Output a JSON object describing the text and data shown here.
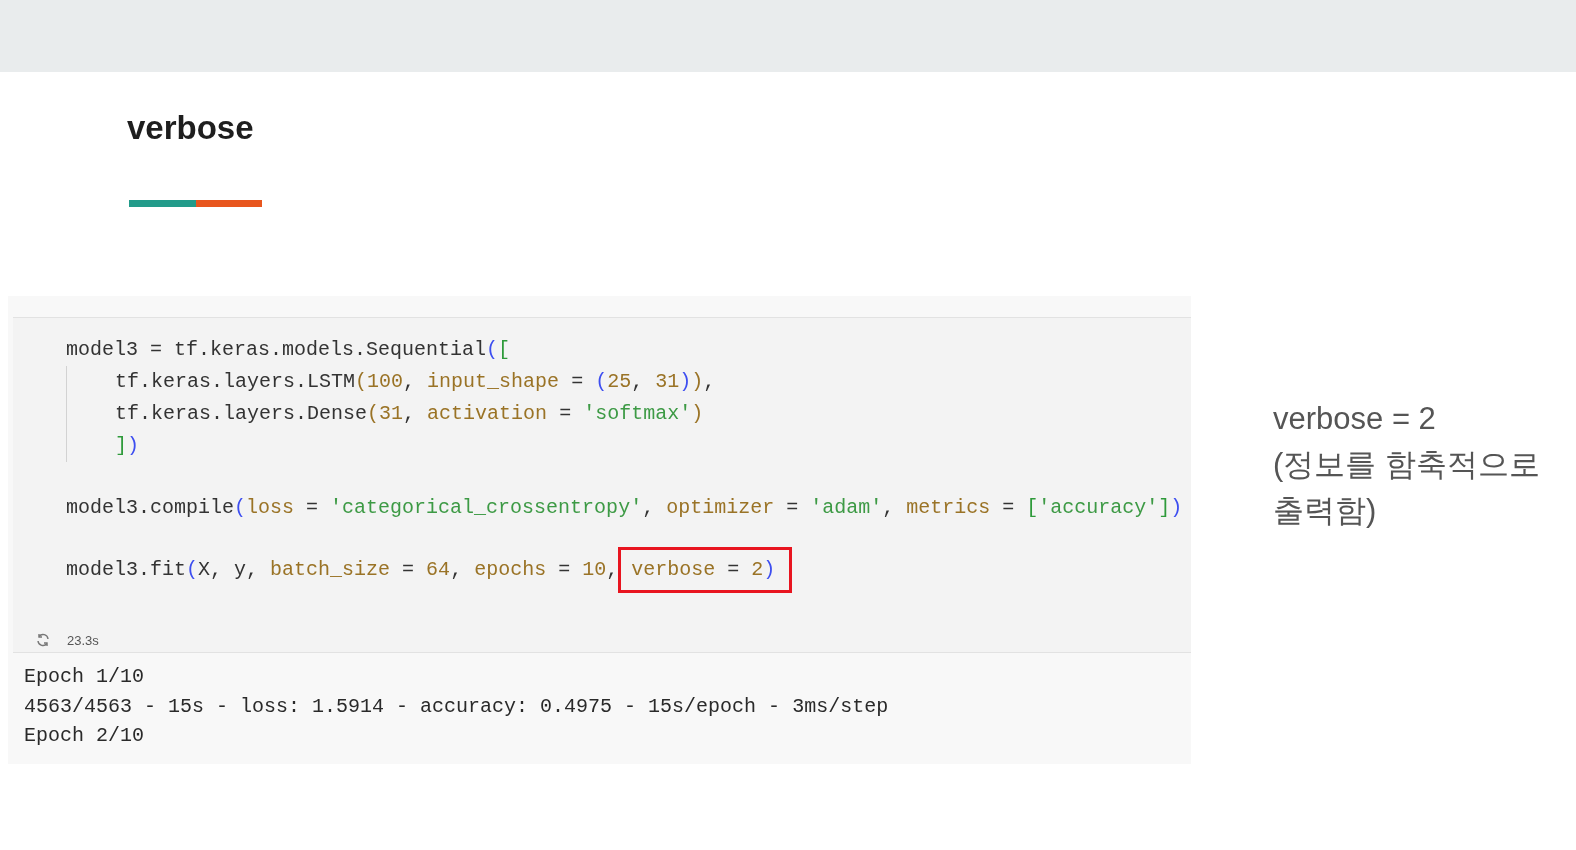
{
  "title": "verbose",
  "code_cell": {
    "blocks": [
      {
        "head": [
          {
            "t": "model3 = tf.keras.models.Sequential",
            "kind": "plain"
          },
          {
            "t": "(",
            "kind": "blue"
          },
          {
            "t": "[",
            "kind": "green"
          }
        ],
        "children": [
          [
            {
              "t": "tf.keras.layers.LSTM",
              "kind": "plain"
            },
            {
              "t": "(",
              "kind": "brown"
            },
            {
              "t": "100",
              "kind": "num"
            },
            {
              "t": ", ",
              "kind": "plain"
            },
            {
              "t": "input_shape",
              "kind": "arg"
            },
            {
              "t": " = ",
              "kind": "plain"
            },
            {
              "t": "(",
              "kind": "blue"
            },
            {
              "t": "25",
              "kind": "num"
            },
            {
              "t": ", ",
              "kind": "plain"
            },
            {
              "t": "31",
              "kind": "num"
            },
            {
              "t": ")",
              "kind": "blue"
            },
            {
              "t": ")",
              "kind": "brown"
            },
            {
              "t": ",",
              "kind": "plain"
            }
          ],
          [
            {
              "t": "tf.keras.layers.Dense",
              "kind": "plain"
            },
            {
              "t": "(",
              "kind": "brown"
            },
            {
              "t": "31",
              "kind": "num"
            },
            {
              "t": ", ",
              "kind": "plain"
            },
            {
              "t": "activation",
              "kind": "arg"
            },
            {
              "t": " = ",
              "kind": "plain"
            },
            {
              "t": "'softmax'",
              "kind": "str"
            },
            {
              "t": ")",
              "kind": "brown"
            }
          ],
          [
            {
              "t": "]",
              "kind": "green"
            },
            {
              "t": ")",
              "kind": "blue"
            }
          ]
        ]
      },
      {
        "head": [
          {
            "t": "model3.compile",
            "kind": "plain"
          },
          {
            "t": "(",
            "kind": "blue"
          },
          {
            "t": "loss",
            "kind": "arg"
          },
          {
            "t": " = ",
            "kind": "plain"
          },
          {
            "t": "'categorical_crossentropy'",
            "kind": "str"
          },
          {
            "t": ", ",
            "kind": "plain"
          },
          {
            "t": "optimizer",
            "kind": "arg"
          },
          {
            "t": " = ",
            "kind": "plain"
          },
          {
            "t": "'adam'",
            "kind": "str"
          },
          {
            "t": ", ",
            "kind": "plain"
          },
          {
            "t": "metrics",
            "kind": "arg"
          },
          {
            "t": " = ",
            "kind": "plain"
          },
          {
            "t": "[",
            "kind": "green"
          },
          {
            "t": "'accuracy'",
            "kind": "str"
          },
          {
            "t": "]",
            "kind": "green"
          },
          {
            "t": ")",
            "kind": "blue"
          }
        ]
      },
      {
        "head": [
          {
            "t": "model3.fit",
            "kind": "plain"
          },
          {
            "t": "(",
            "kind": "blue"
          },
          {
            "t": "X, y, ",
            "kind": "plain"
          },
          {
            "t": "batch_size",
            "kind": "arg"
          },
          {
            "t": " = ",
            "kind": "plain"
          },
          {
            "t": "64",
            "kind": "num"
          },
          {
            "t": ", ",
            "kind": "plain"
          },
          {
            "t": "epochs",
            "kind": "arg"
          },
          {
            "t": " = ",
            "kind": "plain"
          },
          {
            "t": "10",
            "kind": "num"
          },
          {
            "t": ",",
            "kind": "plain"
          }
        ],
        "boxed": [
          {
            "t": "verbose",
            "kind": "arg"
          },
          {
            "t": " = ",
            "kind": "plain"
          },
          {
            "t": "2",
            "kind": "num"
          },
          {
            "t": ")",
            "kind": "blue"
          }
        ]
      }
    ],
    "run_time": "23.3s",
    "output": [
      "Epoch 1/10",
      "4563/4563 - 15s - loss: 1.5914 - accuracy: 0.4975 - 15s/epoch - 3ms/step",
      "Epoch 2/10"
    ]
  },
  "note": [
    "verbose = 2",
    "(정보를 함축적으로",
    "출력함)"
  ]
}
